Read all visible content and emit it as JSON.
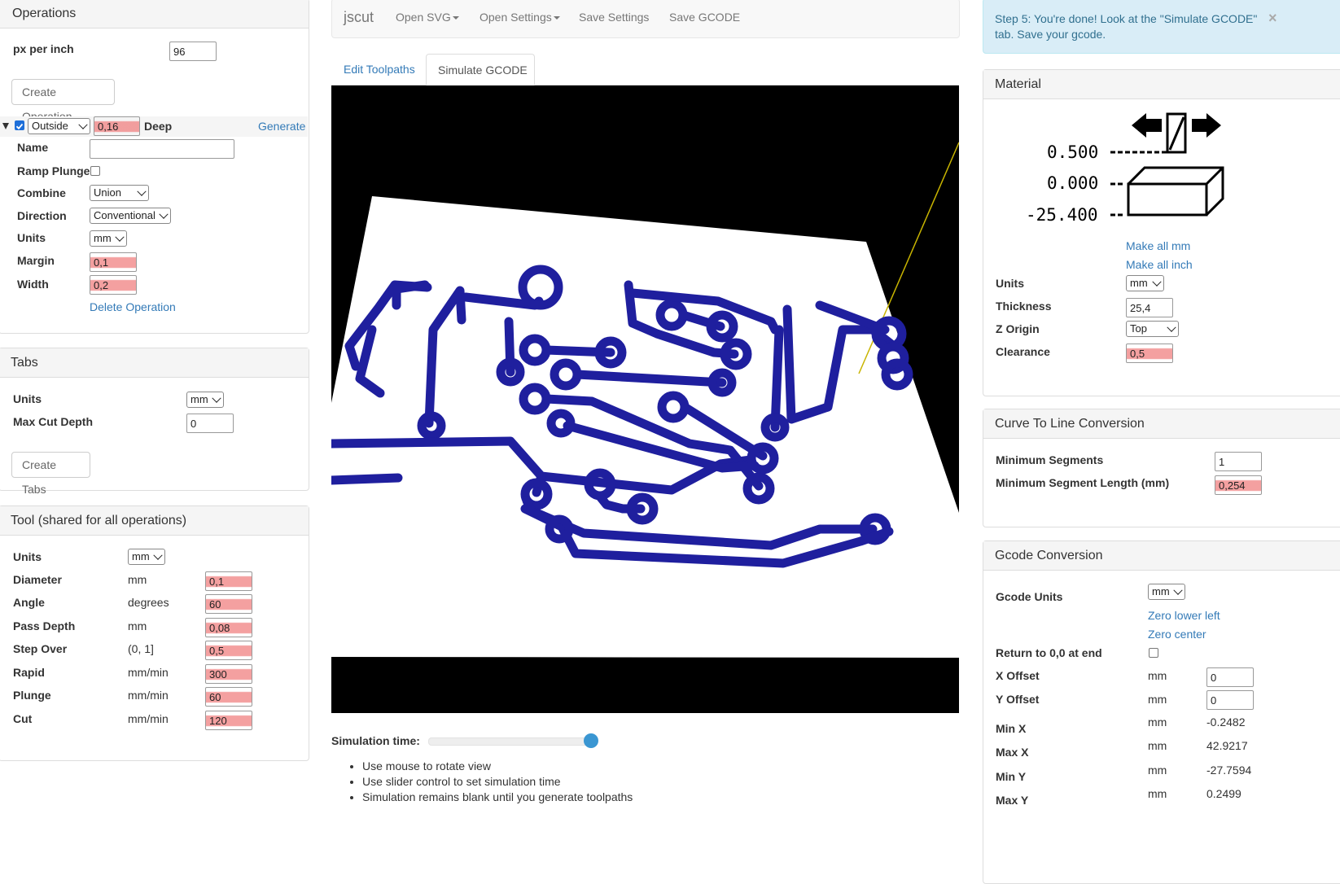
{
  "operations": {
    "title": "Operations",
    "px_per_inch_label": "px per inch",
    "px_per_inch_value": "96",
    "create_button": "Create Operation",
    "op": {
      "type": "Outside",
      "depth": "0,16",
      "deep_label": "Deep",
      "generate": "Generate",
      "name_label": "Name",
      "name_value": "",
      "ramp_label": "Ramp Plunge",
      "combine_label": "Combine",
      "combine_value": "Union",
      "direction_label": "Direction",
      "direction_value": "Conventional",
      "units_label": "Units",
      "units_value": "mm",
      "margin_label": "Margin",
      "margin_value": "0,1",
      "width_label": "Width",
      "width_value": "0,2",
      "delete": "Delete Operation"
    }
  },
  "tabs_panel": {
    "title": "Tabs",
    "units_label": "Units",
    "units_value": "mm",
    "max_cut_label": "Max Cut Depth",
    "max_cut_value": "0",
    "create_button": "Create Tabs"
  },
  "tool": {
    "title": "Tool (shared for all operations)",
    "units_label": "Units",
    "units_value": "mm",
    "rows": [
      {
        "label": "Diameter",
        "unit": "mm",
        "value": "0,1"
      },
      {
        "label": "Angle",
        "unit": "degrees",
        "value": "60"
      },
      {
        "label": "Pass Depth",
        "unit": "mm",
        "value": "0,08"
      },
      {
        "label": "Step Over",
        "unit": "(0, 1]",
        "value": "0,5"
      },
      {
        "label": "Rapid",
        "unit": "mm/min",
        "value": "300"
      },
      {
        "label": "Plunge",
        "unit": "mm/min",
        "value": "60"
      },
      {
        "label": "Cut",
        "unit": "mm/min",
        "value": "120"
      }
    ]
  },
  "navbar": {
    "brand": "jscut",
    "open_svg": "Open SVG",
    "open_settings": "Open Settings",
    "save_settings": "Save Settings",
    "save_gcode": "Save GCODE"
  },
  "view_tabs": {
    "edit": "Edit Toolpaths",
    "simulate": "Simulate GCODE"
  },
  "simulation": {
    "time_label": "Simulation time:",
    "slider_value": 1.0,
    "hints": [
      "Use mouse to rotate view",
      "Use slider control to set simulation time",
      "Simulation remains blank until you generate toolpaths"
    ]
  },
  "alert": {
    "text": "Step 5: You're done! Look at the \"Simulate GCODE\" tab. Save your gcode.",
    "close": "×"
  },
  "material": {
    "title": "Material",
    "diagram": {
      "top": "0.500",
      "mid": "0.000",
      "bottom": "-25.400"
    },
    "make_mm": "Make all mm",
    "make_inch": "Make all inch",
    "units_label": "Units",
    "units_value": "mm",
    "thickness_label": "Thickness",
    "thickness_value": "25,4",
    "zorigin_label": "Z Origin",
    "zorigin_value": "Top",
    "clearance_label": "Clearance",
    "clearance_value": "0,5"
  },
  "curve": {
    "title": "Curve To Line Conversion",
    "min_seg_label": "Minimum Segments",
    "min_seg_value": "1",
    "min_len_label": "Minimum Segment Length (mm)",
    "min_len_value": "0,254"
  },
  "gcode": {
    "title": "Gcode Conversion",
    "units_label": "Gcode Units",
    "units_value": "mm",
    "zero_ll": "Zero lower left",
    "zero_center": "Zero center",
    "return_label": "Return to 0,0 at end",
    "xoff_label": "X Offset",
    "xoff_unit": "mm",
    "xoff_value": "0",
    "yoff_label": "Y Offset",
    "yoff_unit": "mm",
    "yoff_value": "0",
    "stats": [
      {
        "label": "Min X",
        "unit": "mm",
        "value": "-0.2482"
      },
      {
        "label": "Max X",
        "unit": "mm",
        "value": "42.9217"
      },
      {
        "label": "Min Y",
        "unit": "mm",
        "value": "-27.7594"
      },
      {
        "label": "Max Y",
        "unit": "mm",
        "value": "0.2499"
      }
    ]
  },
  "colors": {
    "toolpath": "#1f1f9e",
    "link": "#337ab7",
    "alert_bg": "#d9edf7",
    "highlight": "#f08080"
  }
}
